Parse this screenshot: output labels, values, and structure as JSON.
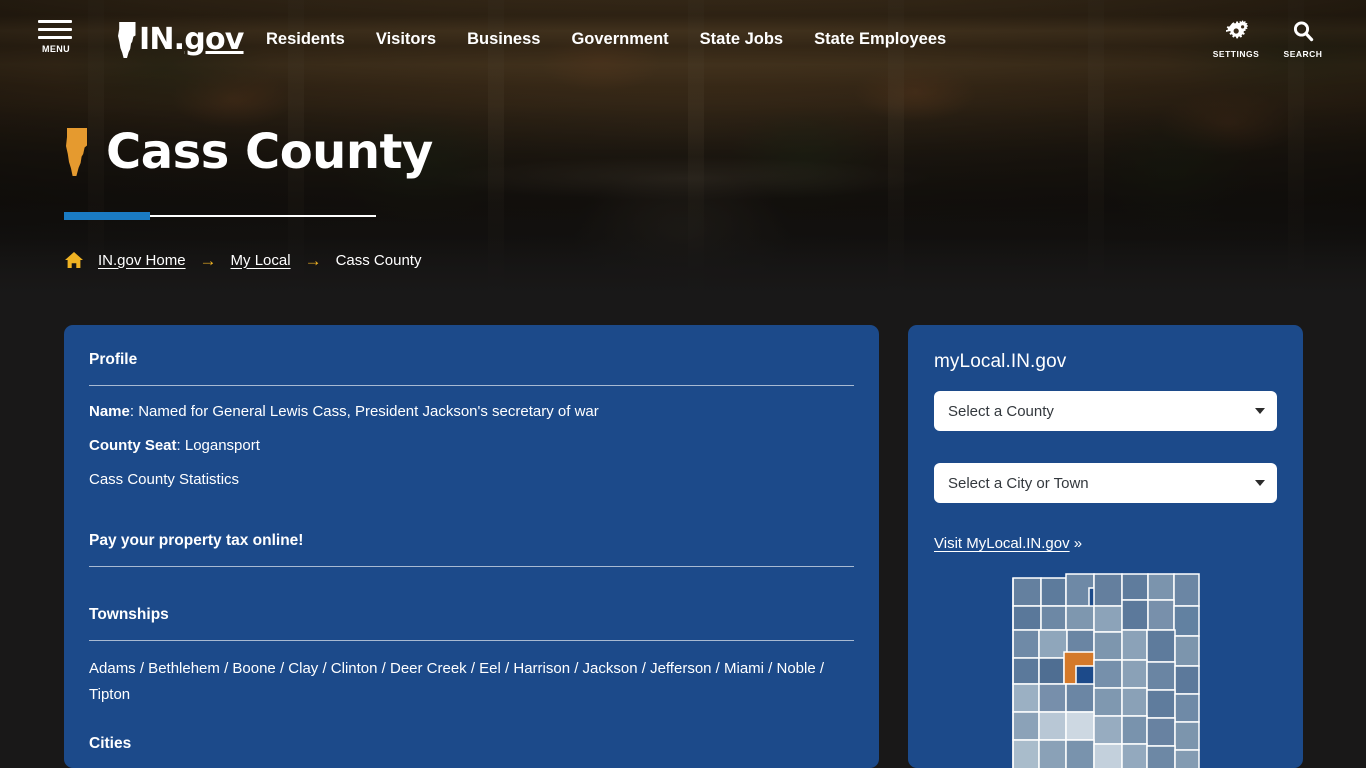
{
  "site": {
    "logo_text_in": "IN",
    "logo_text_dot": ".",
    "logo_text_gov": "gov",
    "menu_label": "MENU"
  },
  "topnav": {
    "items": [
      {
        "label": "Residents"
      },
      {
        "label": "Visitors"
      },
      {
        "label": "Business"
      },
      {
        "label": "Government"
      },
      {
        "label": "State Jobs"
      },
      {
        "label": "State Employees"
      }
    ],
    "utilities": [
      {
        "label": "SETTINGS",
        "icon": "gears-icon"
      },
      {
        "label": "SEARCH",
        "icon": "magnifier-icon"
      }
    ]
  },
  "hero": {
    "title": "Cass County",
    "accent_color": "#1a7bc4",
    "icon": "indiana-state-outline-icon",
    "icon_color": "#e59a2f"
  },
  "breadcrumb": {
    "home_icon": "home-icon",
    "separator": "→",
    "items": [
      {
        "label": "IN.gov Home",
        "link": true
      },
      {
        "label": "My Local",
        "link": true
      },
      {
        "label": "Cass County",
        "link": false
      }
    ]
  },
  "profile": {
    "heading": "Profile",
    "name_label": "Name",
    "name_value": ": Named for General Lewis Cass, President Jackson's secretary of war",
    "seat_label": "County Seat",
    "seat_value": ": Logansport",
    "statistics_link": "Cass County Statistics",
    "tax_heading": "Pay your property tax online!"
  },
  "townships": {
    "heading": "Townships",
    "list_text": "Adams / Bethlehem / Boone / Clay / Clinton / Deer Creek / Eel / Harrison / Jackson / Jefferson / Miami / Noble / Tipton"
  },
  "cities": {
    "heading": "Cities"
  },
  "mylocal": {
    "title": "myLocal.IN.gov",
    "county_select_value": "Select a County",
    "city_select_value": "Select a City or Town",
    "visit_label": "Visit MyLocal.IN.gov",
    "visit_suffix": "»",
    "map_alt": "Indiana county map with Cass County highlighted",
    "map_highlight_color": "#d4792a",
    "map_bg_color": "#1c4a8a"
  },
  "colors": {
    "panel_blue": "#1c4a8a",
    "page_bg": "#191818",
    "accent_gold": "#f0b323",
    "accent_blue": "#1a7bc4"
  }
}
